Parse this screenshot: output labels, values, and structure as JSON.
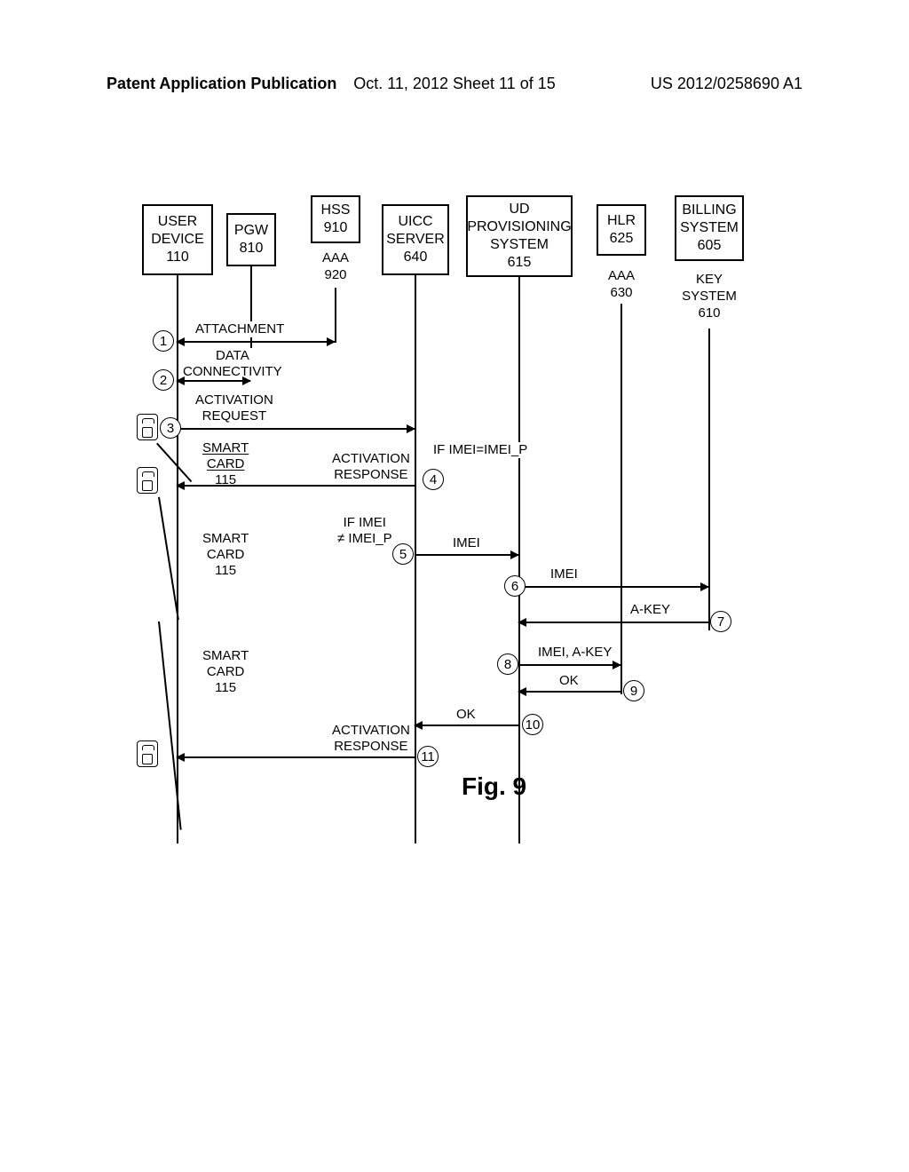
{
  "header": {
    "left": "Patent Application Publication",
    "center": "Oct. 11, 2012  Sheet 11 of 15",
    "right": "US 2012/0258690 A1"
  },
  "boxes": {
    "ud": "USER\nDEVICE\n110",
    "pgw": "PGW\n810",
    "hss": "HSS\n910",
    "uicc": "UICC\nSERVER\n640",
    "udp": "UD\nPROVISIONING\nSYSTEM\n615",
    "hlr": "HLR\n625",
    "bill": "BILLING\nSYSTEM\n605"
  },
  "sublabels": {
    "aaa920": "AAA\n920",
    "aaa630": "AAA\n630",
    "key": "KEY\nSYSTEM\n610"
  },
  "sc": {
    "a": "SMART\nCARD\n115",
    "b": "SMART\nCARD\n115",
    "c": "SMART\nCARD\n115"
  },
  "steps": {
    "s1": "ATTACHMENT",
    "s2": "DATA\nCONNECTIVITY",
    "s3": "ACTIVATION\nREQUEST",
    "s4": "ACTIVATION\nRESPONSE",
    "s4c": "IF IMEI=IMEI_P",
    "s5c": "IF IMEI\n≠ IMEI_P",
    "s5": "IMEI",
    "s6": "IMEI",
    "s7": "A-KEY",
    "s8": "IMEI, A-KEY",
    "s9": "OK",
    "s10": "OK",
    "s11": "ACTIVATION\nRESPONSE"
  },
  "nums": {
    "n1": "1",
    "n2": "2",
    "n3": "3",
    "n4": "4",
    "n5": "5",
    "n6": "6",
    "n7": "7",
    "n8": "8",
    "n9": "9",
    "n10": "10",
    "n11": "11"
  },
  "figure": "Fig. 9"
}
